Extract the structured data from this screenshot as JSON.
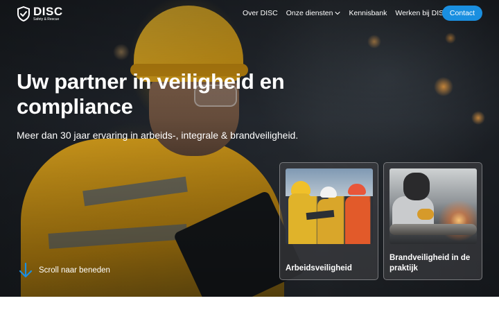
{
  "brand": {
    "name": "DISC",
    "tagline": "Safety & Rescue",
    "accent_color": "#1a8fe0"
  },
  "nav": {
    "items": [
      {
        "label": "Over DISC"
      },
      {
        "label": "Onze diensten",
        "icon": "chevron-down-icon"
      },
      {
        "label": "Kennisbank"
      },
      {
        "label": "Werken bij DISC"
      }
    ],
    "contact_label": "Contact"
  },
  "hero": {
    "headline": "Uw partner in veiligheid en compliance",
    "subline": "Meer dan 30 jaar ervaring in arbeids-, integrale & brandveiligheid.",
    "scroll_label": "Scroll naar beneden",
    "scroll_icon": "arrow-down-icon"
  },
  "cards": [
    {
      "title": "Arbeidsveiligheid",
      "image": "workers-with-tablet-photo"
    },
    {
      "title": "Brandveiligheid in de praktijk",
      "image": "welder-sparks-photo"
    }
  ]
}
